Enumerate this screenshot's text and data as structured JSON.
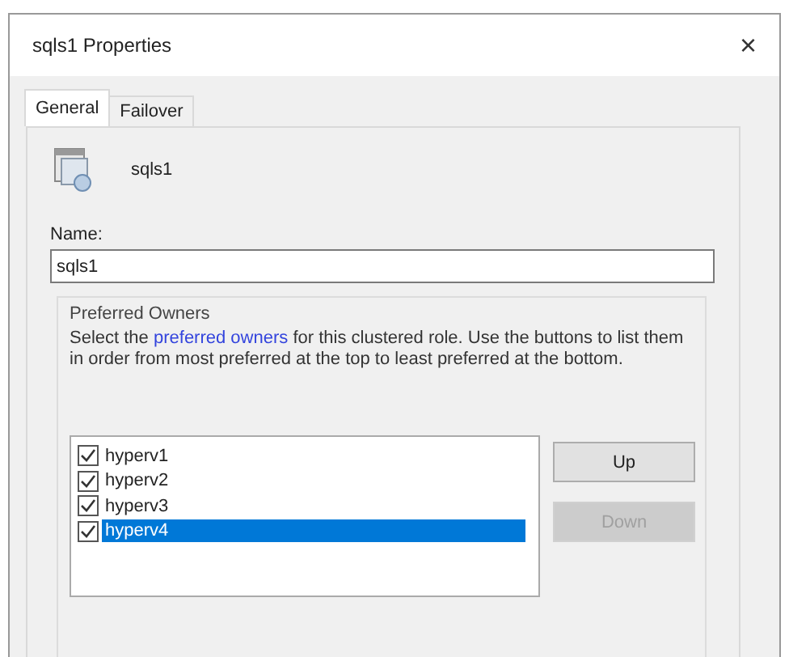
{
  "window": {
    "title": "sqls1 Properties",
    "close": "×"
  },
  "tabs": [
    {
      "label": "General",
      "selected": true
    },
    {
      "label": "Failover",
      "selected": false
    }
  ],
  "role": {
    "name": "sqls1"
  },
  "name_field": {
    "label": "Name:",
    "value": "sqls1"
  },
  "preferred_owners": {
    "title": "Preferred Owners",
    "text_before": "Select the ",
    "link": "preferred owners",
    "text_after": " for this clustered role. Use the buttons to list them in order from most preferred at the top to least preferred at the bottom.",
    "owners": [
      {
        "name": "hyperv1",
        "checked": true,
        "selected": false
      },
      {
        "name": "hyperv2",
        "checked": true,
        "selected": false
      },
      {
        "name": "hyperv3",
        "checked": true,
        "selected": false
      },
      {
        "name": "hyperv4",
        "checked": true,
        "selected": true
      }
    ],
    "buttons": [
      {
        "label": "Up",
        "disabled": false
      },
      {
        "label": "Down",
        "disabled": true
      }
    ]
  }
}
